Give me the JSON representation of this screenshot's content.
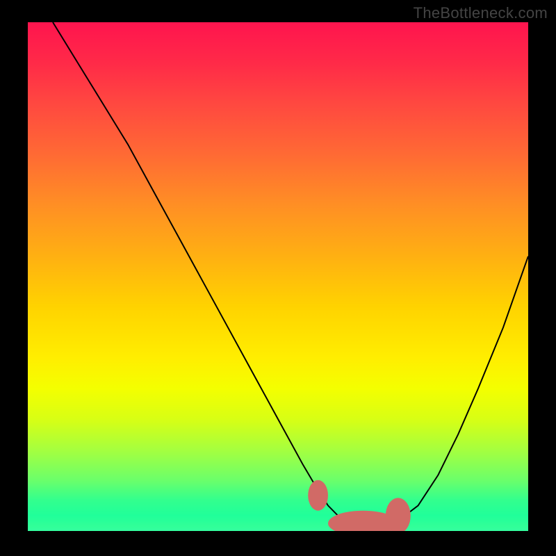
{
  "watermark": "TheBottleneck.com",
  "chart_data": {
    "type": "line",
    "title": "",
    "xlabel": "",
    "ylabel": "",
    "xlim": [
      0,
      100
    ],
    "ylim": [
      0,
      100
    ],
    "grid": false,
    "series": [
      {
        "name": "curve",
        "x": [
          5,
          10,
          15,
          20,
          25,
          30,
          35,
          40,
          45,
          50,
          55,
          58,
          60,
          63,
          67,
          72,
          74,
          78,
          82,
          86,
          90,
          95,
          100
        ],
        "y": [
          100,
          92,
          84,
          76,
          67,
          58,
          49,
          40,
          31,
          22,
          13,
          8,
          5,
          2,
          1,
          1,
          2,
          5,
          11,
          19,
          28,
          40,
          54
        ]
      }
    ],
    "markers": [
      {
        "name": "blob-left",
        "x": 58,
        "y": 7,
        "rx": 2,
        "ry": 3
      },
      {
        "name": "blob-mid",
        "x": 67,
        "y": 1.5,
        "rx": 7,
        "ry": 2.5
      },
      {
        "name": "blob-right",
        "x": 74,
        "y": 3,
        "rx": 2.5,
        "ry": 3.5
      }
    ],
    "background": {
      "type": "gradient",
      "direction": "top-to-bottom",
      "stops": [
        {
          "pos": 0,
          "color": "#ff144e"
        },
        {
          "pos": 26,
          "color": "#ff6a34"
        },
        {
          "pos": 56,
          "color": "#ffd300"
        },
        {
          "pos": 72,
          "color": "#f4ff00"
        },
        {
          "pos": 90,
          "color": "#6bff6a"
        },
        {
          "pos": 100,
          "color": "#34ff9f"
        }
      ]
    }
  }
}
